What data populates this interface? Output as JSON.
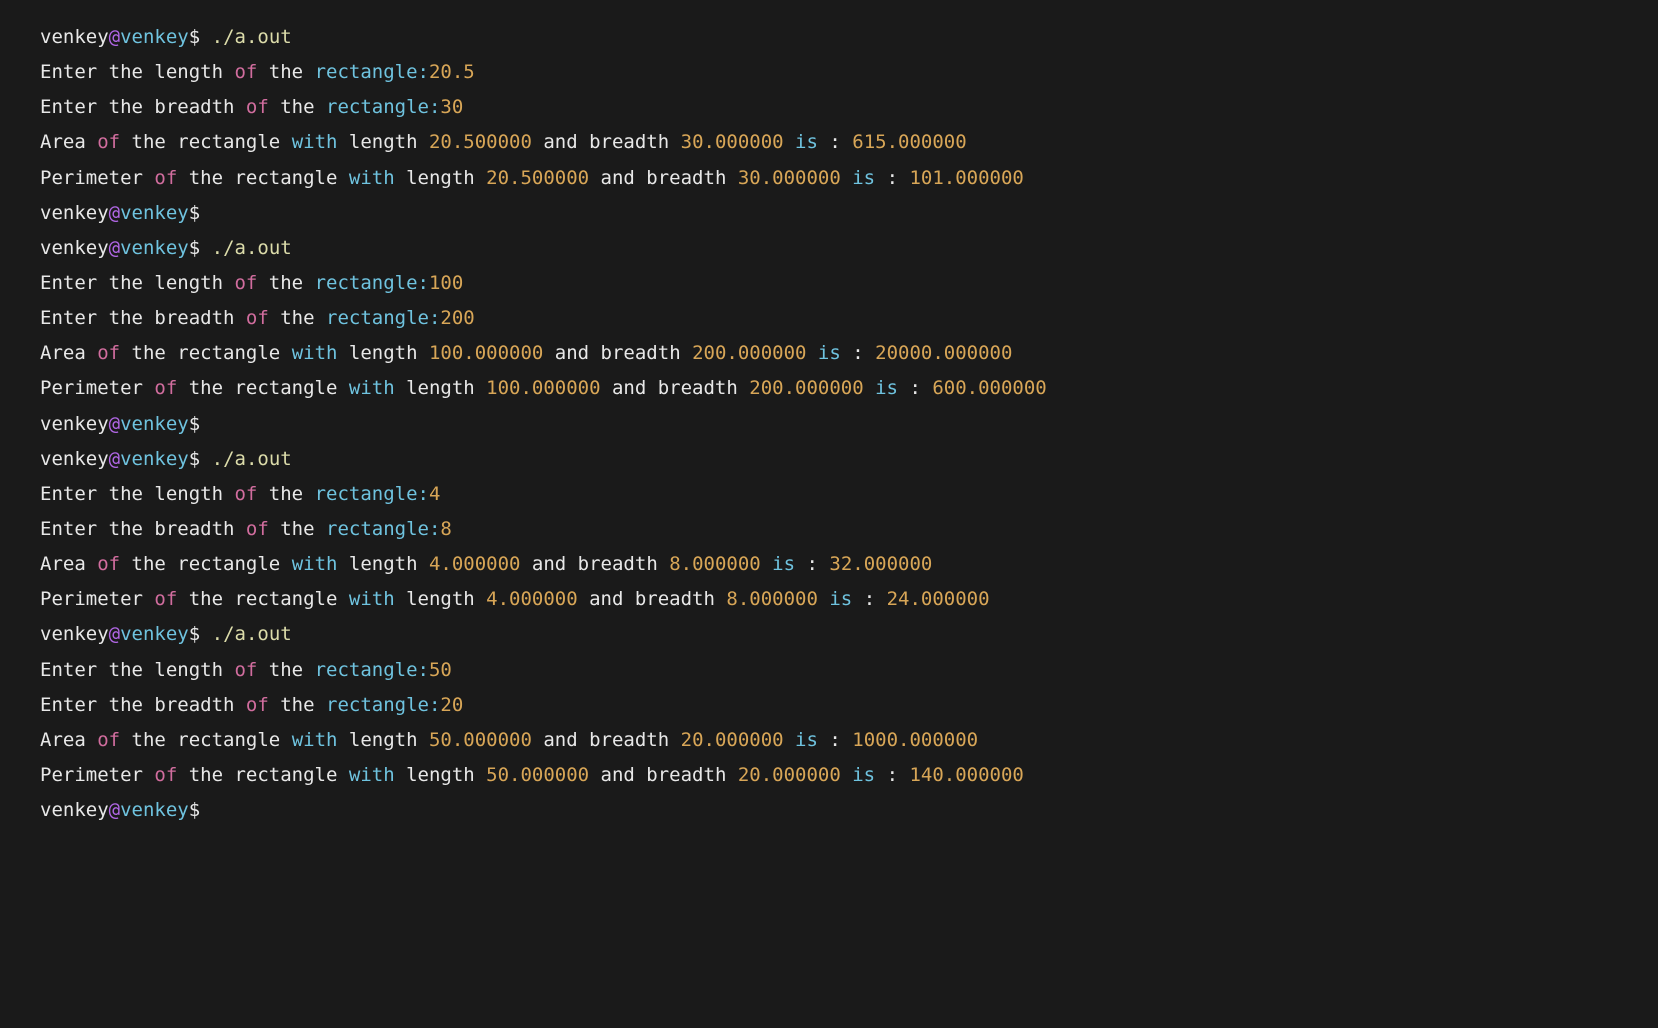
{
  "prompt": {
    "user": "venkey",
    "at": "@",
    "host": "venkey",
    "dollar": "$",
    "cmd": "./a.out"
  },
  "words": {
    "enter_the": "Enter the",
    "length": "length",
    "breadth": "breadth",
    "of": "of",
    "the": "the",
    "rectangle": "rectangle:",
    "area": "Area",
    "perimeter": "Perimeter",
    "rectangle2": "rectangle",
    "with": "with",
    "and": "and",
    "is": "is",
    "colon_sp": " : "
  },
  "runs": [
    {
      "length_in": "20.5",
      "breadth_in": "30",
      "length_val": "20.500000",
      "breadth_val": "30.000000",
      "area": "615.000000",
      "perimeter": "101.000000",
      "empty_prompt_after": true
    },
    {
      "length_in": "100",
      "breadth_in": "200",
      "length_val": "100.000000",
      "breadth_val": "200.000000",
      "area": "20000.000000",
      "perimeter": "600.000000",
      "empty_prompt_after": true
    },
    {
      "length_in": "4",
      "breadth_in": "8",
      "length_val": "4.000000",
      "breadth_val": "8.000000",
      "area": "32.000000",
      "perimeter": "24.000000",
      "empty_prompt_after": false
    },
    {
      "length_in": "50",
      "breadth_in": "20",
      "length_val": "50.000000",
      "breadth_val": "20.000000",
      "area": "1000.000000",
      "perimeter": "140.000000",
      "empty_prompt_after": false
    }
  ]
}
